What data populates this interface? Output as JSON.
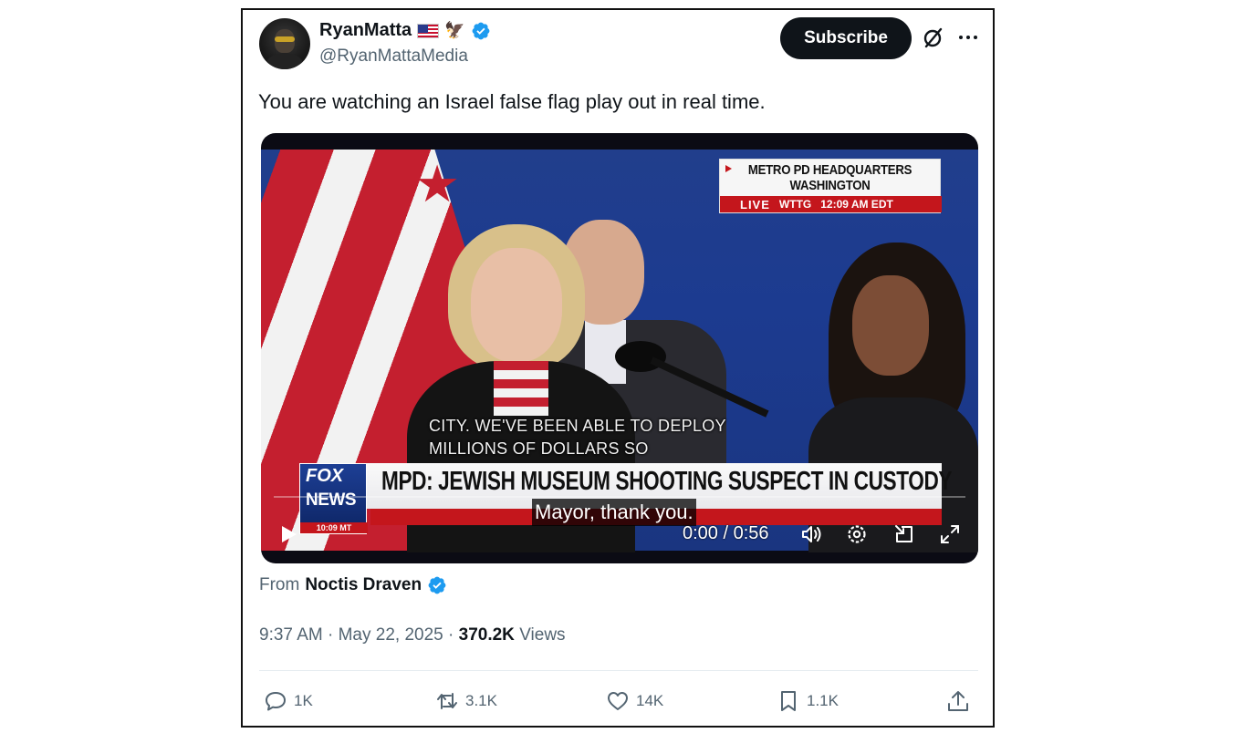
{
  "author": {
    "display_name": "RyanMatta",
    "handle": "@RyanMattaMedia",
    "verified": true,
    "badges": [
      "us-flag-emoji",
      "eagle-emoji"
    ]
  },
  "header": {
    "subscribe_label": "Subscribe",
    "grok_icon": "grok-icon",
    "more_icon": "more-icon"
  },
  "tweet": {
    "text": "You are watching an Israel false flag play out in real time."
  },
  "video": {
    "location_line1": "METRO PD HEADQUARTERS",
    "location_line2": "WASHINGTON",
    "live_tag": "LIVE",
    "station": "WTTG",
    "broadcast_time": "12:09 AM EDT",
    "caption_line1": "CITY. WE'VE BEEN ABLE TO DEPLOY",
    "caption_line2": "MILLIONS OF DOLLARS SO",
    "chyron": "MPD: JEWISH MUSEUM SHOOTING SUSPECT IN CUSTODY",
    "network_line1": "FOX",
    "network_line2": "NEWS",
    "network_time": "10:09 MT",
    "subtitle": "Mayor, thank you.",
    "timecode": "0:00 / 0:56",
    "progress": 0.0,
    "controls": [
      "play-icon",
      "volume-icon",
      "settings-icon",
      "picture-in-picture-icon",
      "fullscreen-icon"
    ]
  },
  "source": {
    "label": "From",
    "name": "Noctis Draven",
    "verified": true
  },
  "meta": {
    "time": "9:37 AM",
    "separator": "·",
    "date": "May 22, 2025",
    "views_count": "370.2K",
    "views_label": "Views"
  },
  "actions": {
    "replies": "1K",
    "reposts": "3.1K",
    "likes": "14K",
    "bookmarks": "1.1K"
  },
  "colors": {
    "accent": "#1d9bf0",
    "text": "#0f1419",
    "secondary_text": "#536471",
    "subscribe_bg": "#0f1419"
  }
}
